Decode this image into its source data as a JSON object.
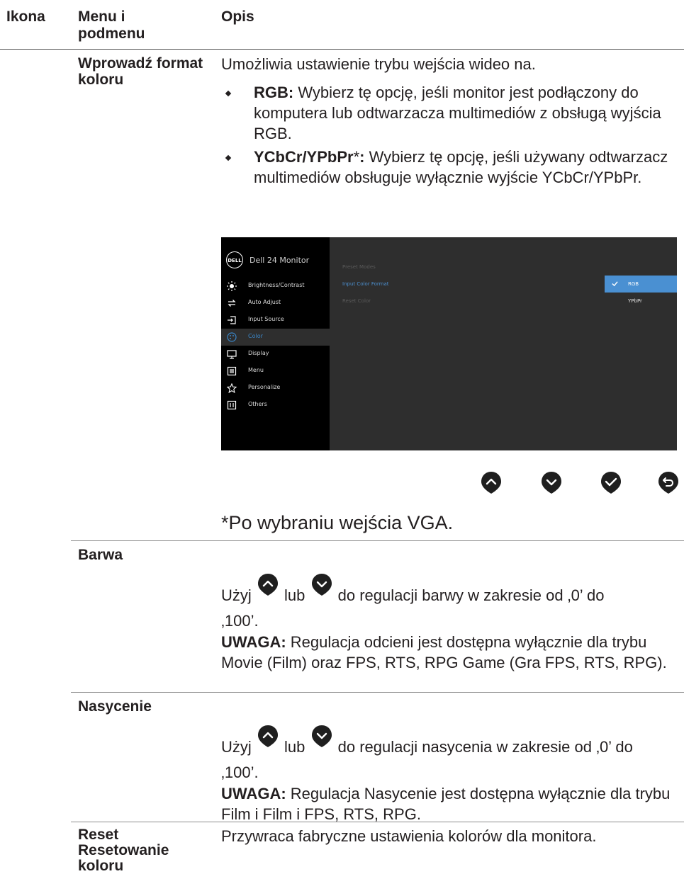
{
  "header": {
    "col_icon": "Ikona",
    "col_menu": "Menu i podmenu",
    "col_desc": "Opis"
  },
  "input_color_format": {
    "label": "Wprowadź format koloru",
    "intro": "Umożliwia ustawienie trybu wejścia wideo na.",
    "bullets": [
      {
        "term": "RGB:",
        "text": " Wybierz tę opcję, jeśli monitor jest podłączony do komputera lub odtwarzacza multimediów z obsługą wyjścia RGB."
      },
      {
        "term": "YCbCr/YPbPr",
        "star": "*",
        "colon": ":",
        "text": " Wybierz tę opcję, jeśli używany odtwarzacz multimediów obsługuje wyłącznie wyjście YCbCr/YPbPr."
      }
    ],
    "footnote": "*Po wybraniu wejścia VGA."
  },
  "osd": {
    "logo": "DELL",
    "title": "Dell 24 Monitor",
    "menu": [
      {
        "label": "Brightness/Contrast",
        "icon": "brightness-icon"
      },
      {
        "label": "Auto Adjust",
        "icon": "auto-adjust-icon"
      },
      {
        "label": "Input Source",
        "icon": "input-source-icon"
      },
      {
        "label": "Color",
        "icon": "color-icon",
        "active": true
      },
      {
        "label": "Display",
        "icon": "display-icon"
      },
      {
        "label": "Menu",
        "icon": "menu-icon"
      },
      {
        "label": "Personalize",
        "icon": "star-icon"
      },
      {
        "label": "Others",
        "icon": "others-icon"
      }
    ],
    "submenu": [
      "Preset Modes",
      "Input Color Format",
      "Reset Color"
    ],
    "options": [
      "RGB",
      "YPbPr"
    ],
    "selected_option": "RGB"
  },
  "hue": {
    "label": "Barwa",
    "line1_a": "Użyj",
    "line1_b": "lub",
    "line1_c": "do regulacji barwy w zakresie od ‚0’ do",
    "line2": "‚100’.",
    "note_label": "UWAGA:",
    "note_text": " Regulacja odcieni jest dostępna wyłącznie dla trybu Movie (Film) oraz FPS,  RTS, RPG Game (Gra FPS, RTS, RPG)."
  },
  "saturation": {
    "label": "Nasycenie",
    "line1_a": "Użyj",
    "line1_b": "lub",
    "line1_c": "do regulacji nasycenia w zakresie od ‚0’ do",
    "line2": "‚100’.",
    "note_label": "UWAGA:",
    "note_text": " Regulacja Nasycenie jest dostępna wyłącznie dla trybu Film i Film i FPS, RTS, RPG."
  },
  "reset": {
    "label_lines": [
      "Reset",
      "Resetowanie",
      "koloru"
    ],
    "text": "Przywraca fabryczne ustawienia kolorów dla monitora."
  },
  "colors": {
    "button": "#1f1f1f",
    "osd_highlight": "#4a90d2",
    "osd_active_text": "#3a86c8"
  }
}
